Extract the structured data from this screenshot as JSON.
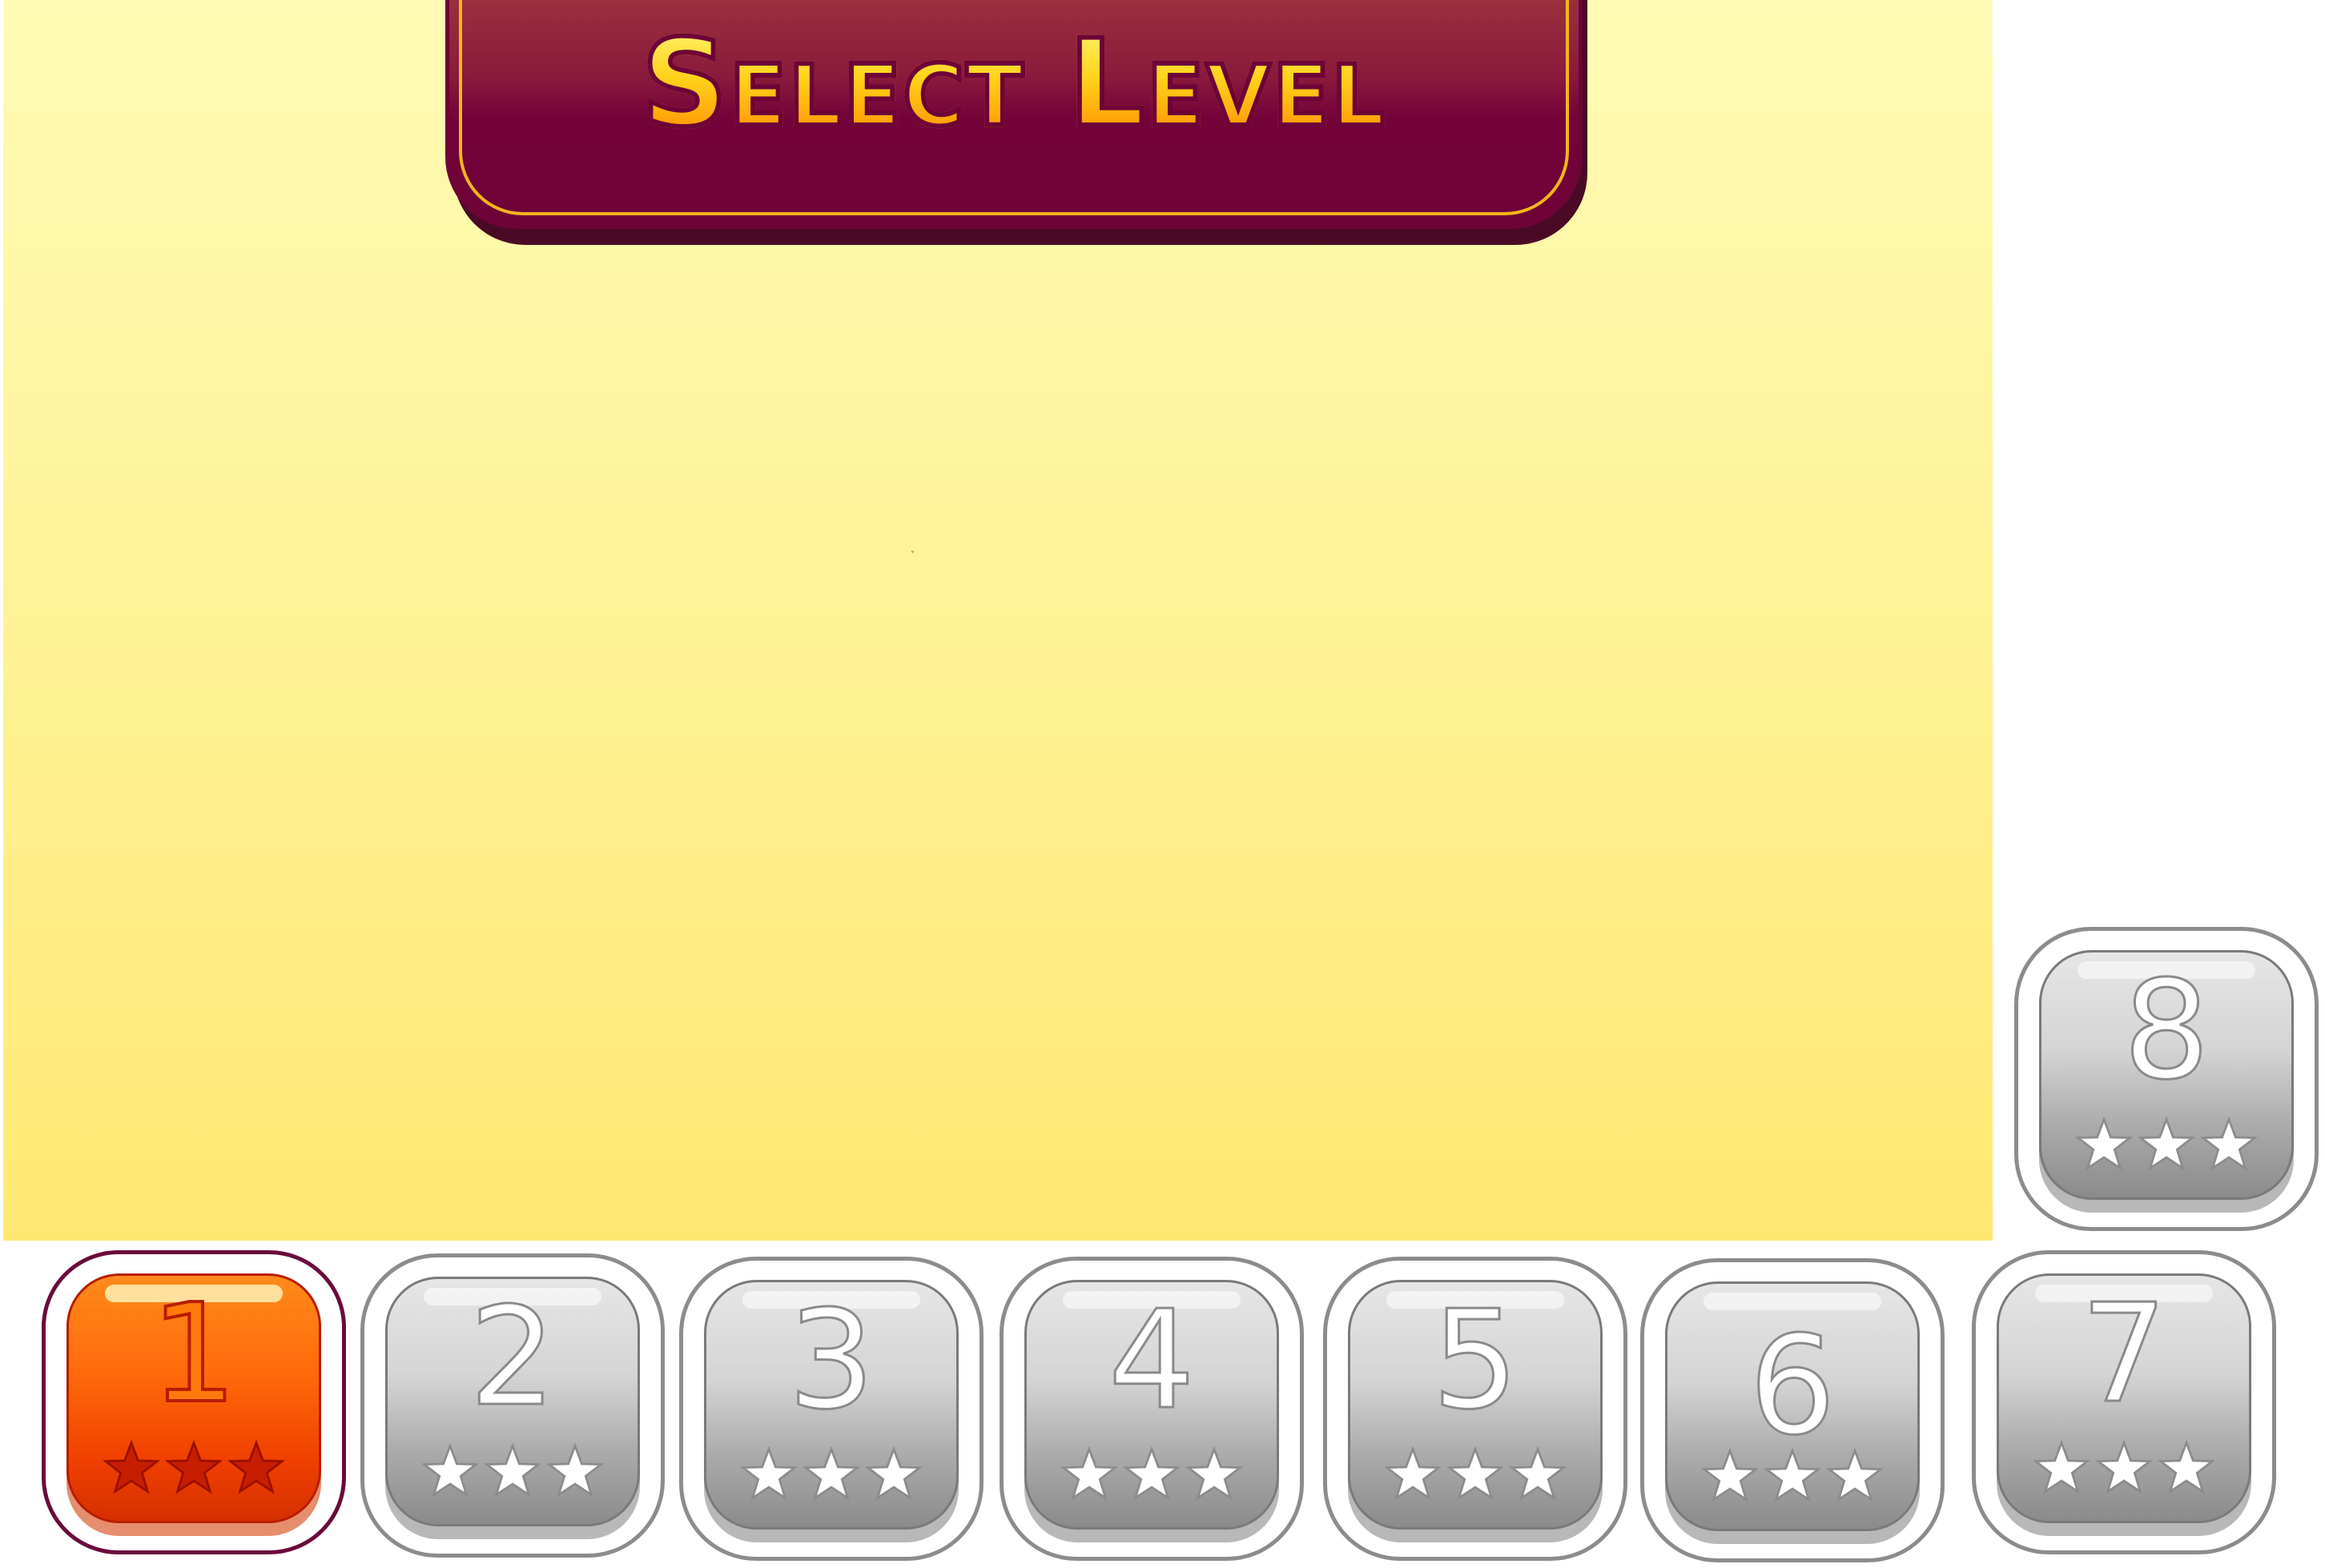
{
  "title": "Select Level",
  "colors": {
    "banner": "#740339",
    "banner_rim": "#f4b51c",
    "title_fill": "#ffcc18",
    "active_button": "#f04000",
    "locked_button": "#b8b8b8",
    "background_top": "#fffbb4",
    "background_bottom": "#ffe872"
  },
  "levels": [
    {
      "number": "1",
      "state": "unlocked",
      "stars_total": 3,
      "icon": "star-icon"
    },
    {
      "number": "2",
      "state": "locked",
      "stars_total": 3,
      "icon": "star-icon"
    },
    {
      "number": "3",
      "state": "locked",
      "stars_total": 3,
      "icon": "star-icon"
    },
    {
      "number": "4",
      "state": "locked",
      "stars_total": 3,
      "icon": "star-icon"
    },
    {
      "number": "5",
      "state": "locked",
      "stars_total": 3,
      "icon": "star-icon"
    },
    {
      "number": "6",
      "state": "locked",
      "stars_total": 3,
      "icon": "star-icon"
    },
    {
      "number": "7",
      "state": "locked",
      "stars_total": 3,
      "icon": "star-icon"
    },
    {
      "number": "8",
      "state": "locked",
      "stars_total": 3,
      "icon": "star-icon"
    }
  ]
}
